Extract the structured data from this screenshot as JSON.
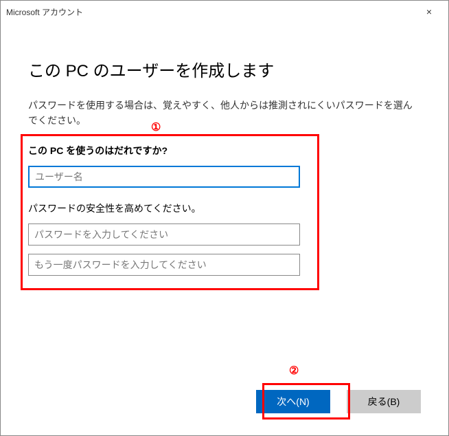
{
  "titlebar": {
    "title": "Microsoft アカウント",
    "close_label": "×"
  },
  "content": {
    "heading": "この PC のユーザーを作成します",
    "description": "パスワードを使用する場合は、覚えやすく、他人からは推測されにくいパスワードを選んでください。"
  },
  "form": {
    "username_label": "この PC を使うのはだれですか?",
    "username_placeholder": "ユーザー名",
    "username_value": "",
    "password_label": "パスワードの安全性を高めてください。",
    "password_placeholder": "パスワードを入力してください",
    "password_value": "",
    "password_confirm_placeholder": "もう一度パスワードを入力してください",
    "password_confirm_value": ""
  },
  "buttons": {
    "next_label": "次へ(N)",
    "back_label": "戻る(B)"
  },
  "annotations": {
    "marker1": "①",
    "marker2": "②"
  }
}
